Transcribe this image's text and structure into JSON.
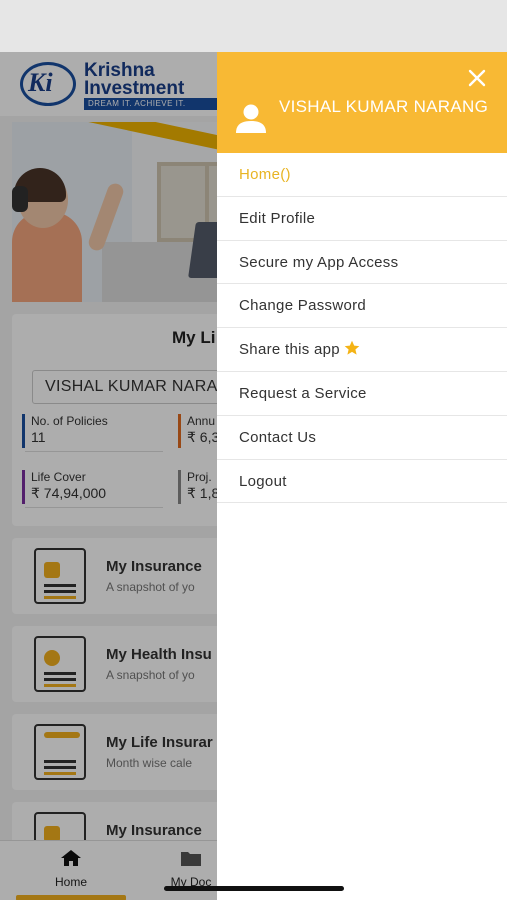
{
  "background_app": {
    "logo": {
      "mark": "Ki",
      "name": "Krishna Investment",
      "tagline": "DREAM IT. ACHIEVE IT."
    },
    "policy_card": {
      "title": "My Li",
      "holder_name": "VISHAL KUMAR NARAN",
      "metrics": [
        {
          "label": "No. of Policies",
          "value": "11",
          "color": "#1a4fa0"
        },
        {
          "label": "Annu",
          "value": "₹ 6,3",
          "color": "#e06a1f"
        },
        {
          "label": "Life Cover",
          "value": "₹ 74,94,000",
          "color": "#7b2fa0"
        },
        {
          "label": "Proj.",
          "value": "₹ 1,8",
          "color": "#888888"
        }
      ]
    },
    "features": [
      {
        "title": "My Insurance",
        "subtitle": "A snapshot of yo",
        "icon": "document-icon"
      },
      {
        "title": "My Health Insu",
        "subtitle": "A snapshot of yo",
        "icon": "health-card-icon"
      },
      {
        "title": "My Life Insurar",
        "subtitle": "Month wise cale",
        "icon": "calendar-icon"
      },
      {
        "title": "My Insurance",
        "subtitle": "",
        "icon": "coins-chart-icon"
      }
    ],
    "bottom_nav": [
      {
        "label": "Home",
        "icon": "home-icon"
      },
      {
        "label": "My Doc",
        "icon": "folder-icon"
      }
    ]
  },
  "drawer": {
    "user_name": "VISHAL KUMAR NARANG",
    "accent_color": "#f8b934",
    "menu": [
      {
        "label": "Home()",
        "active": true
      },
      {
        "label": "Edit Profile"
      },
      {
        "label": "Secure my App Access"
      },
      {
        "label": "Change Password"
      },
      {
        "label": "Share this app",
        "icon": "star-icon"
      },
      {
        "label": "Request a Service"
      },
      {
        "label": "Contact Us"
      },
      {
        "label": "Logout"
      }
    ]
  }
}
